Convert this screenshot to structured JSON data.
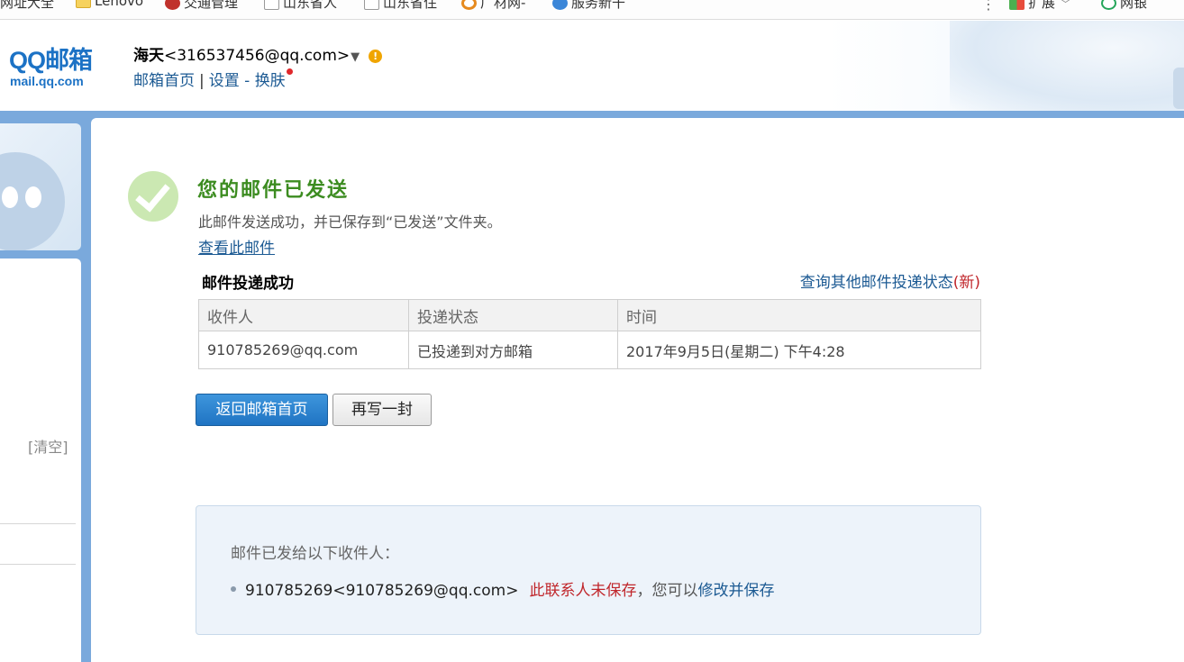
{
  "bookmarks": [
    {
      "label": "网址大全",
      "icon": "none"
    },
    {
      "label": "Lenovo",
      "icon": "folder-icon"
    },
    {
      "label": "交通管理",
      "icon": "traffic-icon"
    },
    {
      "label": "山东省人",
      "icon": "page-icon"
    },
    {
      "label": "山东省住",
      "icon": "page-icon"
    },
    {
      "label": "广材网-",
      "icon": "search-icon"
    },
    {
      "label": "服务新干",
      "icon": "globe-icon"
    },
    {
      "label": "扩展",
      "icon": "extension-grid-icon"
    },
    {
      "label": "网银",
      "icon": "bank-coin-icon"
    }
  ],
  "header": {
    "logo_main": "QQ邮箱",
    "logo_sub": "mail.qq.com",
    "user_name": "海天",
    "user_email": "<316537456@qq.com>",
    "nav": {
      "home": "邮箱首页",
      "separator": "|",
      "settings": "设置",
      "dash": " - ",
      "skin": "换肤"
    }
  },
  "sidebar": {
    "clear_label": "[清空]"
  },
  "result": {
    "title": "您的邮件已发送",
    "description": "此邮件发送成功，并已保存到“已发送”文件夹。",
    "view_link": "查看此邮件",
    "section_title": "邮件投递成功",
    "query_link": "查询其他邮件投递状态",
    "query_new": "(新)",
    "table": {
      "headers": [
        "收件人",
        "投递状态",
        "时间"
      ],
      "rows": [
        [
          "910785269@qq.com",
          "已投递到对方邮箱",
          "2017年9月5日(星期二) 下午4:28"
        ]
      ]
    },
    "buttons": {
      "back_home": "返回邮箱首页",
      "write_again": "再写一封"
    }
  },
  "notice": {
    "label": "邮件已发给以下收件人：",
    "recipient": "910785269<910785269@qq.com>",
    "unsaved": "此联系人未保存",
    "tip": "，您可以",
    "save_link": "修改并保存"
  },
  "colors": {
    "brand_blue": "#1c72c5",
    "link_blue": "#1c5a93",
    "success_green": "#3c8c20",
    "alert_red": "#c0262b",
    "frame_blue": "#7aa9dc"
  }
}
